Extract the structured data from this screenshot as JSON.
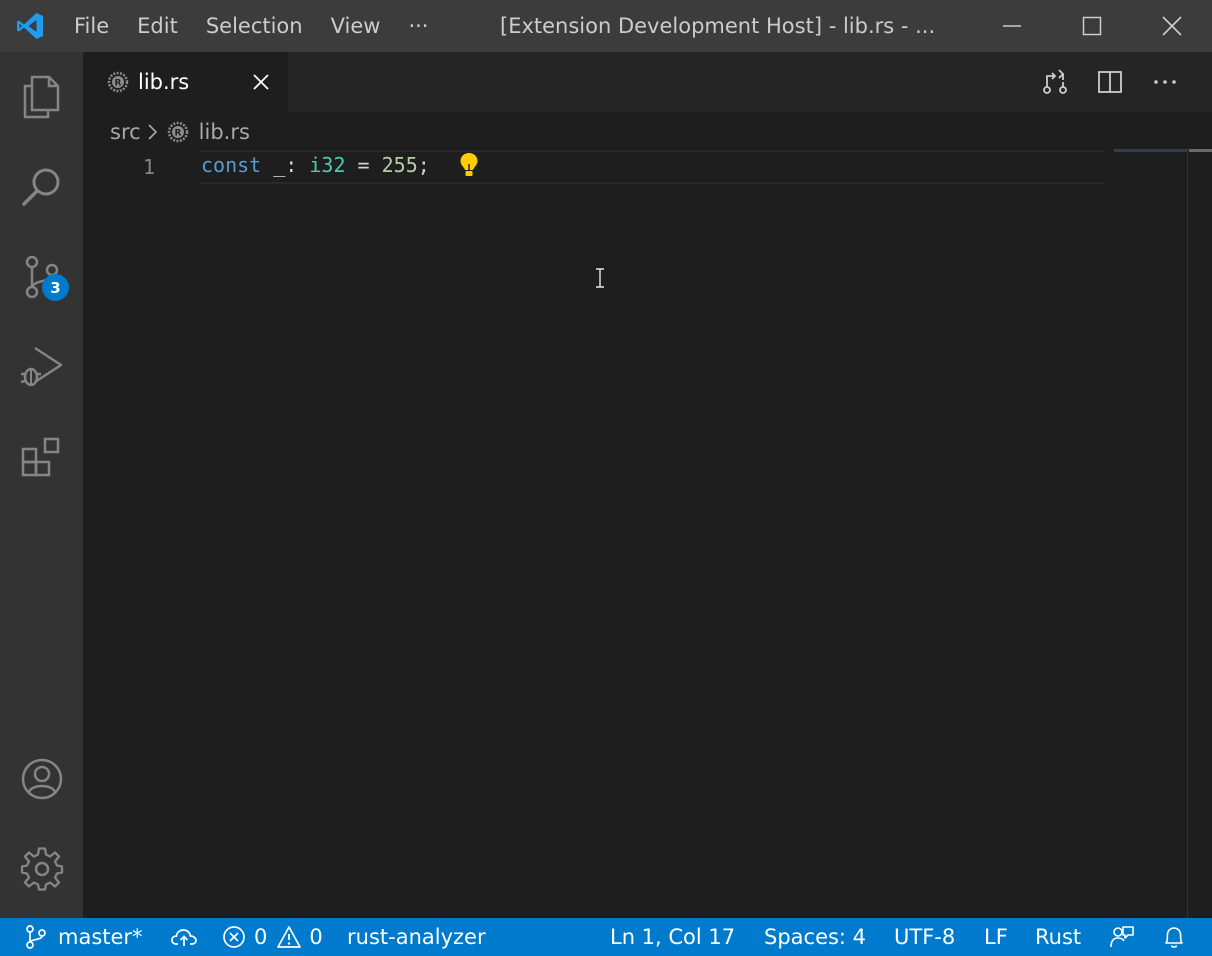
{
  "titlebar": {
    "menu": [
      "File",
      "Edit",
      "Selection",
      "View",
      "···"
    ],
    "window_title": "[Extension Development Host] - lib.rs - ..."
  },
  "activitybar": {
    "items": [
      "explorer-icon",
      "search-icon",
      "source-control-icon",
      "run-debug-icon",
      "extensions-icon",
      "account-icon",
      "settings-gear-icon"
    ],
    "source_control_badge": "3"
  },
  "tabs": [
    {
      "label": "lib.rs",
      "icon": "rust-file-icon",
      "active": true
    }
  ],
  "breadcrumb": {
    "folder": "src",
    "file": "lib.rs"
  },
  "editor": {
    "line_number": "1",
    "code": {
      "keyword": "const",
      "name": " _: ",
      "type": "i32",
      "assign": " = ",
      "number": "255",
      "end": ";"
    }
  },
  "statusbar": {
    "branch": "master*",
    "errors": "0",
    "warnings": "0",
    "language_server": "rust-analyzer",
    "cursor_position": "Ln 1, Col 17",
    "indentation": "Spaces: 4",
    "encoding": "UTF-8",
    "eol": "LF",
    "language": "Rust"
  },
  "colors": {
    "statusbar_bg": "#007acc",
    "activitybar_bg": "#333333",
    "titlebar_bg": "#3c3c3c",
    "editor_bg": "#1e1e1e",
    "keyword": "#569cd6",
    "type": "#4ec9b0",
    "number": "#b5cea8",
    "lightbulb": "#ffcc00"
  }
}
